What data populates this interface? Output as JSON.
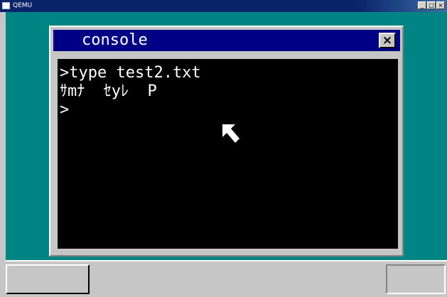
{
  "host_window": {
    "title": "QEMU",
    "controls": {
      "minimize": "_",
      "maximize": "□",
      "close": "×"
    }
  },
  "console_window": {
    "title": "console",
    "close_symbol": "×"
  },
  "terminal": {
    "lines": [
      ">type test2.txt",
      "ｻmﾅ  ｾyﾚ  P",
      ">"
    ]
  },
  "icons": {
    "mouse_pointer": "arrow-cursor-icon",
    "host_app": "window-icon"
  },
  "colors": {
    "desktop": "#008484",
    "title_bar": "#000084",
    "terminal_bg": "#000000",
    "terminal_text": "#ffffff",
    "frame": "#c6c6c6"
  }
}
